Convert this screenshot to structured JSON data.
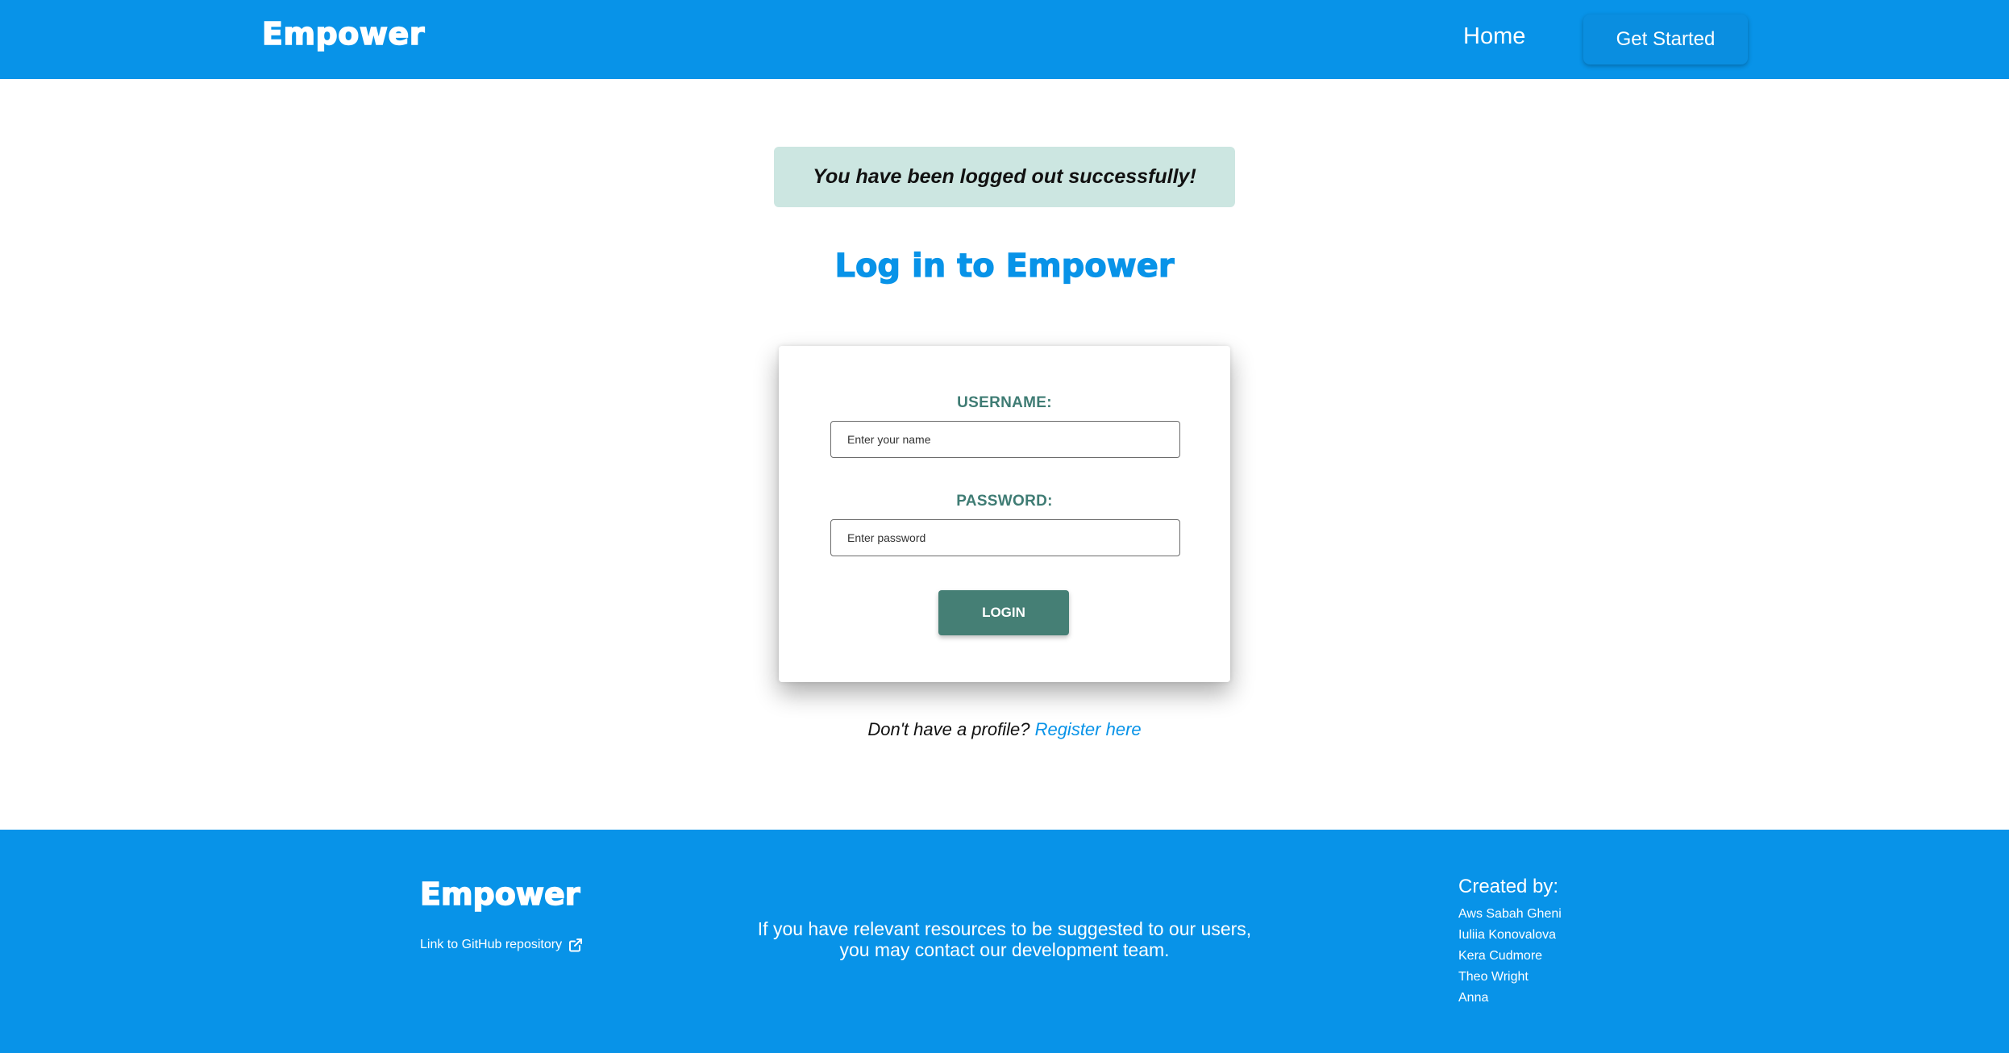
{
  "header": {
    "brand": "Empower",
    "nav_home": "Home",
    "get_started": "Get Started"
  },
  "alert": {
    "message": "You have been logged out successfully!"
  },
  "page": {
    "title": "Log in to Empower"
  },
  "form": {
    "username_label": "USERNAME:",
    "username_placeholder": "Enter your name",
    "password_label": "PASSWORD:",
    "password_placeholder": "Enter password",
    "login_label": "LOGIN"
  },
  "register": {
    "prompt": "Don't have a profile?",
    "link": "Register here"
  },
  "footer": {
    "brand": "Empower",
    "github_link": "Link to GitHub repository",
    "contact_line1": "If you have relevant resources to be suggested to our users,",
    "contact_line2": "you may contact our development team.",
    "created_by": "Created by:",
    "creators": [
      "Aws Sabah Gheni",
      "Iuliia Konovalova",
      "Kera Cudmore",
      "Theo Wright",
      "Anna"
    ]
  },
  "colors": {
    "brand_blue": "#0893e8",
    "teal_label": "#3f7c74",
    "button_green": "#457f75",
    "alert_bg": "#cce6e1"
  },
  "icons": {
    "github_link_icon": "external-link-icon"
  }
}
